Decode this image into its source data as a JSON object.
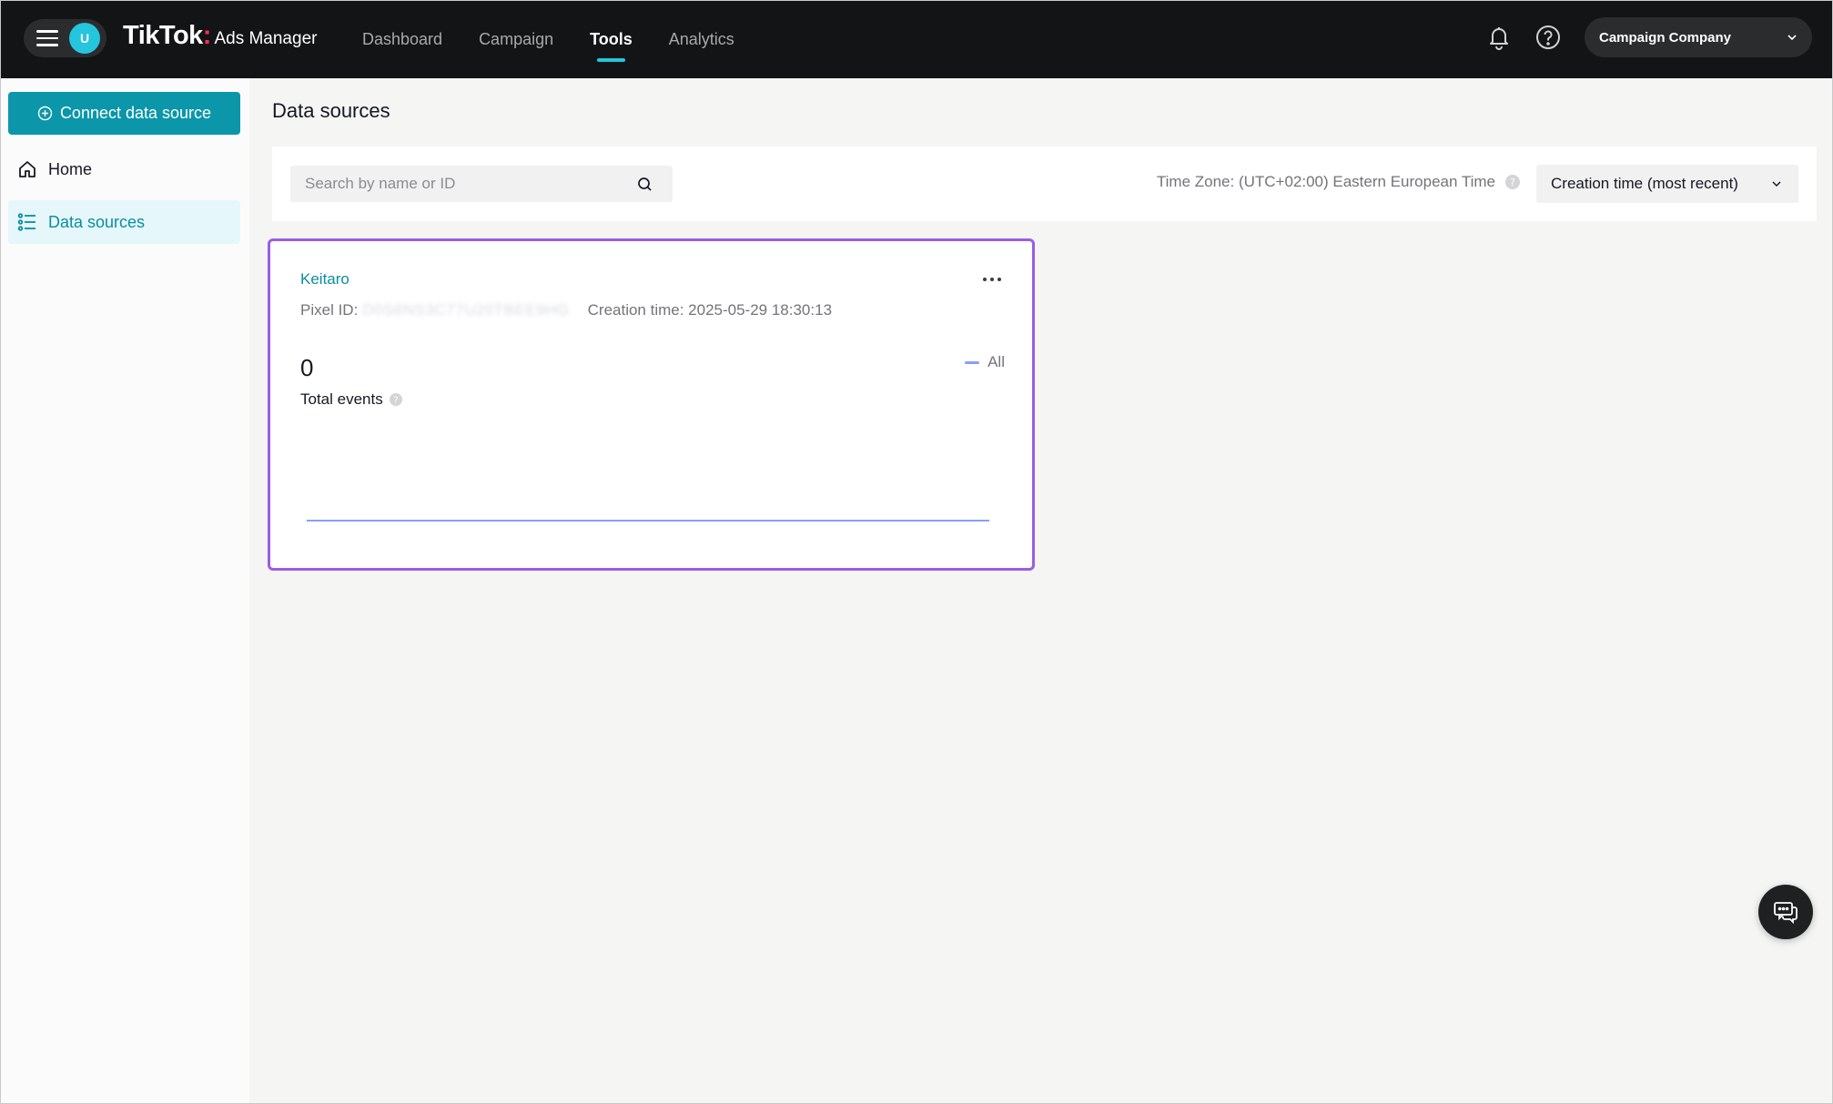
{
  "topbar": {
    "avatar_initial": "U",
    "brand_name": "TikTok",
    "brand_product": "Ads Manager",
    "nav": [
      {
        "label": "Dashboard",
        "active": false
      },
      {
        "label": "Campaign",
        "active": false
      },
      {
        "label": "Tools",
        "active": true
      },
      {
        "label": "Analytics",
        "active": false
      }
    ],
    "account_name": "Campaign Company",
    "icons": [
      "menu-icon",
      "bell-icon",
      "help-icon",
      "chevron-down-icon"
    ]
  },
  "sidebar": {
    "connect_button": "Connect data source",
    "items": [
      {
        "label": "Home",
        "icon": "home-icon",
        "active": false
      },
      {
        "label": "Data sources",
        "icon": "list-icon",
        "active": true
      }
    ]
  },
  "main": {
    "title": "Data sources",
    "search": {
      "placeholder": "Search by name or ID",
      "value": ""
    },
    "timezone": "Time Zone: (UTC+02:00) Eastern European Time",
    "sort": {
      "selected": "Creation time (most recent)"
    },
    "cards": [
      {
        "name": "Keitaro",
        "pixel_id_label": "Pixel ID:",
        "pixel_id_value": "D0S8NS3C77U20TBEE9HG",
        "creation_time": "Creation time: 2025-05-29 18:30:13",
        "total_events": "0",
        "total_events_label": "Total events",
        "legend": "All"
      }
    ]
  },
  "colors": {
    "topbar_bg": "#121415",
    "accent_teal": "#0b96aa",
    "nav_underline": "#25c5dd",
    "card_highlight": "#9b5de5",
    "chart_line": "#8c9ef7"
  },
  "chart_data": {
    "type": "line",
    "series": [
      {
        "name": "All",
        "values": [
          0,
          0,
          0,
          0,
          0,
          0,
          0,
          0
        ]
      }
    ],
    "ylim": [
      0,
      1
    ]
  }
}
